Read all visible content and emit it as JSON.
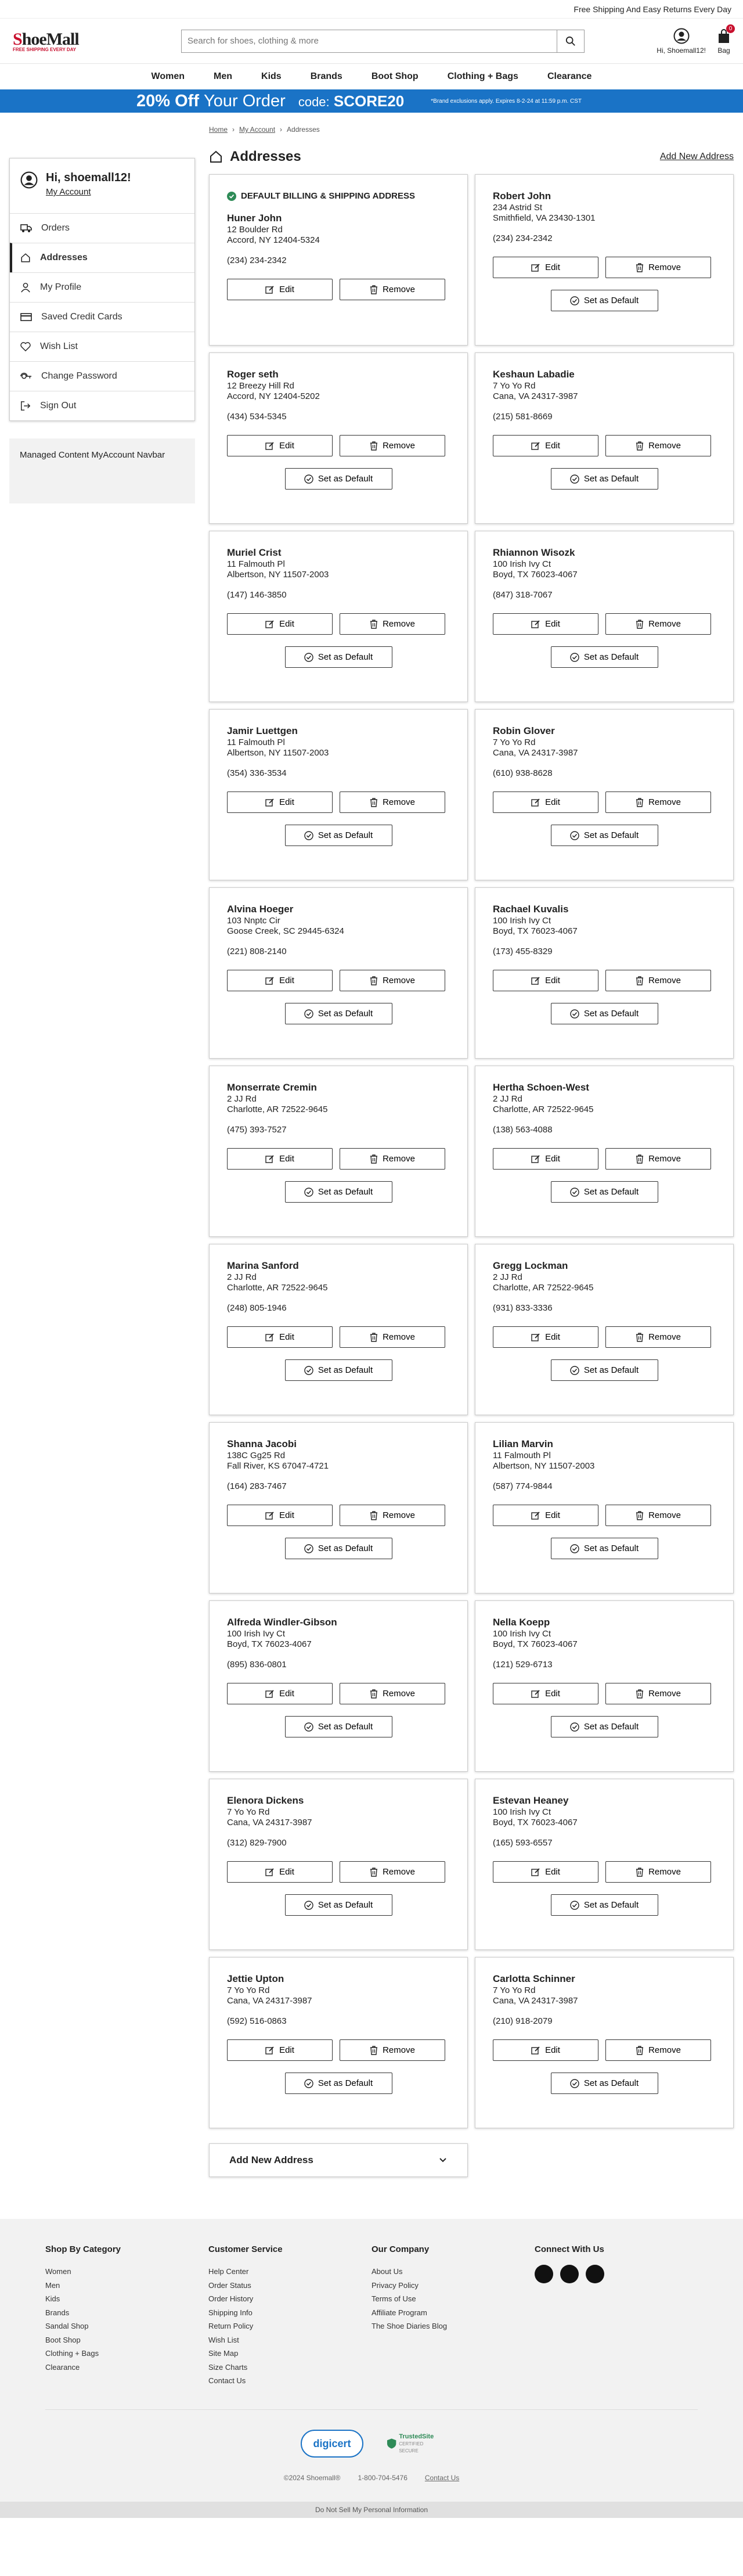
{
  "topbar": {
    "text": "Free Shipping And Easy Returns Every Day"
  },
  "logo": {
    "brand": "ShoeMall",
    "tagline": "FREE SHIPPING EVERY DAY"
  },
  "search": {
    "placeholder": "Search for shoes, clothing & more"
  },
  "header": {
    "user_label": "Hi, Shoemall12!",
    "bag_label": "Bag",
    "bag_count": "0"
  },
  "nav": [
    {
      "label": "Women"
    },
    {
      "label": "Men"
    },
    {
      "label": "Kids"
    },
    {
      "label": "Brands"
    },
    {
      "label": "Boot Shop"
    },
    {
      "label": "Clothing + Bags"
    },
    {
      "label": "Clearance"
    }
  ],
  "promo": {
    "percent": "20% Off",
    "rest": "Your Order",
    "code_label": "code:",
    "code": "SCORE20",
    "fine": "*Brand exclusions apply. Expires 8-2-24 at 11:59 p.m. CST"
  },
  "sidebar": {
    "greeting": "Hi, shoemall12!",
    "account_link": "My Account",
    "items": [
      {
        "label": "Orders",
        "icon": "truck-icon"
      },
      {
        "label": "Addresses",
        "icon": "home-icon"
      },
      {
        "label": "My Profile",
        "icon": "user-icon"
      },
      {
        "label": "Saved Credit Cards",
        "icon": "card-icon"
      },
      {
        "label": "Wish List",
        "icon": "heart-icon"
      },
      {
        "label": "Change Password",
        "icon": "lock-icon"
      },
      {
        "label": "Sign Out",
        "icon": "signout-icon"
      }
    ],
    "managed": "Managed Content MyAccount Navbar"
  },
  "breadcrumb": {
    "home": "Home",
    "account": "My Account",
    "current": "Addresses"
  },
  "page": {
    "title": "Addresses",
    "add_link": "Add New Address"
  },
  "labels": {
    "default_title": "DEFAULT BILLING & SHIPPING ADDRESS",
    "edit": "Edit",
    "remove": "Remove",
    "set_default": "Set as Default",
    "add_new": "Add New Address"
  },
  "addresses": [
    {
      "name": "Huner John",
      "street": "12 Boulder Rd",
      "city": "Accord, NY 12404-5324",
      "phone": "(234) 234-2342",
      "default": true
    },
    {
      "name": "Robert John",
      "street": "234 Astrid St",
      "city": "Smithfield, VA 23430-1301",
      "phone": "(234) 234-2342",
      "default": false
    },
    {
      "name": "Roger seth",
      "street": "12 Breezy Hill Rd",
      "city": "Accord, NY 12404-5202",
      "phone": "(434) 534-5345",
      "default": false
    },
    {
      "name": "Keshaun Labadie",
      "street": "7 Yo Yo Rd",
      "city": "Cana, VA 24317-3987",
      "phone": "(215) 581-8669",
      "default": false
    },
    {
      "name": "Muriel Crist",
      "street": "11 Falmouth Pl",
      "city": "Albertson, NY 11507-2003",
      "phone": "(147) 146-3850",
      "default": false
    },
    {
      "name": "Rhiannon Wisozk",
      "street": "100 Irish Ivy Ct",
      "city": "Boyd, TX 76023-4067",
      "phone": "(847) 318-7067",
      "default": false
    },
    {
      "name": "Jamir Luettgen",
      "street": "11 Falmouth Pl",
      "city": "Albertson, NY 11507-2003",
      "phone": "(354) 336-3534",
      "default": false
    },
    {
      "name": "Robin Glover",
      "street": "7 Yo Yo Rd",
      "city": "Cana, VA 24317-3987",
      "phone": "(610) 938-8628",
      "default": false
    },
    {
      "name": "Alvina Hoeger",
      "street": "103 Nnptc Cir",
      "city": "Goose Creek, SC 29445-6324",
      "phone": "(221) 808-2140",
      "default": false
    },
    {
      "name": "Rachael Kuvalis",
      "street": "100 Irish Ivy Ct",
      "city": "Boyd, TX 76023-4067",
      "phone": "(173) 455-8329",
      "default": false
    },
    {
      "name": "Monserrate Cremin",
      "street": "2 JJ Rd",
      "city": "Charlotte, AR 72522-9645",
      "phone": "(475) 393-7527",
      "default": false
    },
    {
      "name": "Hertha Schoen-West",
      "street": "2 JJ Rd",
      "city": "Charlotte, AR 72522-9645",
      "phone": "(138) 563-4088",
      "default": false
    },
    {
      "name": "Marina Sanford",
      "street": "2 JJ Rd",
      "city": "Charlotte, AR 72522-9645",
      "phone": "(248) 805-1946",
      "default": false
    },
    {
      "name": "Gregg Lockman",
      "street": "2 JJ Rd",
      "city": "Charlotte, AR 72522-9645",
      "phone": "(931) 833-3336",
      "default": false
    },
    {
      "name": "Shanna Jacobi",
      "street": "138C Gg25 Rd",
      "city": "Fall River, KS 67047-4721",
      "phone": "(164) 283-7467",
      "default": false
    },
    {
      "name": "Lilian Marvin",
      "street": "11 Falmouth Pl",
      "city": "Albertson, NY 11507-2003",
      "phone": "(587) 774-9844",
      "default": false
    },
    {
      "name": "Alfreda Windler-Gibson",
      "street": "100 Irish Ivy Ct",
      "city": "Boyd, TX 76023-4067",
      "phone": "(895) 836-0801",
      "default": false
    },
    {
      "name": "Nella Koepp",
      "street": "100 Irish Ivy Ct",
      "city": "Boyd, TX 76023-4067",
      "phone": "(121) 529-6713",
      "default": false
    },
    {
      "name": "Elenora Dickens",
      "street": "7 Yo Yo Rd",
      "city": "Cana, VA 24317-3987",
      "phone": "(312) 829-7900",
      "default": false
    },
    {
      "name": "Estevan Heaney",
      "street": "100 Irish Ivy Ct",
      "city": "Boyd, TX 76023-4067",
      "phone": "(165) 593-6557",
      "default": false
    },
    {
      "name": "Jettie Upton",
      "street": "7 Yo Yo Rd",
      "city": "Cana, VA 24317-3987",
      "phone": "(592) 516-0863",
      "default": false
    },
    {
      "name": "Carlotta Schinner",
      "street": "7 Yo Yo Rd",
      "city": "Cana, VA 24317-3987",
      "phone": "(210) 918-2079",
      "default": false
    }
  ],
  "footer": {
    "columns": [
      {
        "title": "Shop By Category",
        "links": [
          "Women",
          "Men",
          "Kids",
          "Brands",
          "Sandal Shop",
          "Boot Shop",
          "Clothing + Bags",
          "Clearance"
        ]
      },
      {
        "title": "Customer Service",
        "links": [
          "Help Center",
          "Order Status",
          "Order History",
          "Shipping Info",
          "Return Policy",
          "Wish List",
          "Site Map",
          "Size Charts",
          "Contact Us"
        ]
      },
      {
        "title": "Our Company",
        "links": [
          "About Us",
          "Privacy Policy",
          "Terms of Use",
          "Affiliate Program",
          "The Shoe Diaries Blog"
        ]
      }
    ],
    "connect_title": "Connect With Us",
    "digicert": "digicert",
    "trusted": "TrustedSite",
    "trusted_sub": "CERTIFIED SECURE",
    "copyright": "©2024 Shoemall®",
    "phone": "1-800-704-5476",
    "contact": "Contact Us",
    "dns": "Do Not Sell My Personal Information"
  },
  "colors": {
    "brand_red": "#c8102e",
    "promo_blue": "#1a73c6"
  }
}
